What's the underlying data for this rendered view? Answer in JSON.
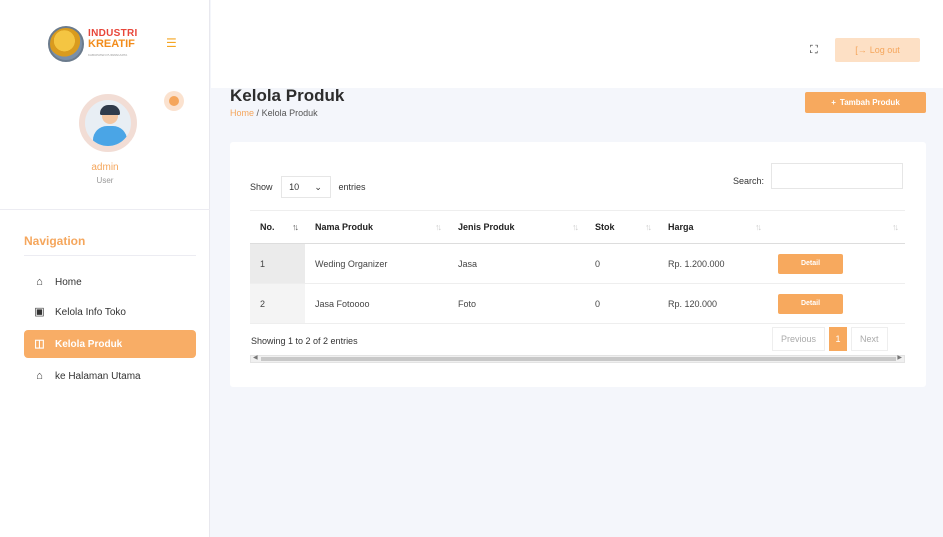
{
  "brand": {
    "line1": "INDUSTRI",
    "line2": "KREATIF",
    "line3": "KABUPATEN PURWAKARTA",
    "menu_icon": "hamburger-icon"
  },
  "user": {
    "name": "admin",
    "role": "User"
  },
  "nav": {
    "title": "Navigation",
    "items": [
      {
        "label": "Home",
        "icon": "home-icon",
        "glyph": "⌂"
      },
      {
        "label": "Kelola Info Toko",
        "icon": "store-icon",
        "glyph": "▣"
      },
      {
        "label": "Kelola Produk",
        "icon": "product-icon",
        "glyph": "◫"
      },
      {
        "label": "ke Halaman Utama",
        "icon": "home-icon",
        "glyph": "⌂"
      }
    ]
  },
  "topbar": {
    "fullscreen_icon": "fullscreen-icon",
    "logout_label": "Log out"
  },
  "page": {
    "title": "Kelola Produk",
    "crumb_home": "Home",
    "crumb_sep": "/",
    "crumb_current": "Kelola Produk",
    "add_label": "Tambah Produk"
  },
  "table_controls": {
    "show": "Show",
    "length": "10",
    "entries": "entries",
    "search_label": "Search:"
  },
  "table": {
    "headers": [
      "No.",
      "Nama Produk",
      "Jenis Produk",
      "Stok",
      "Harga",
      ""
    ],
    "rows": [
      {
        "no": "1",
        "nama": "Weding Organizer",
        "jenis": "Jasa",
        "stok": "0",
        "harga": "Rp. 1.200.000",
        "action": "Detail"
      },
      {
        "no": "2",
        "nama": "Jasa Fotoooo",
        "jenis": "Foto",
        "stok": "0",
        "harga": "Rp. 120.000",
        "action": "Detail"
      }
    ]
  },
  "footer": {
    "info": "Showing 1 to 2 of 2 entries",
    "previous": "Previous",
    "current_page": "1",
    "next": "Next"
  },
  "colors": {
    "accent": "#f7a95e",
    "accent_light": "#fde0c5"
  }
}
